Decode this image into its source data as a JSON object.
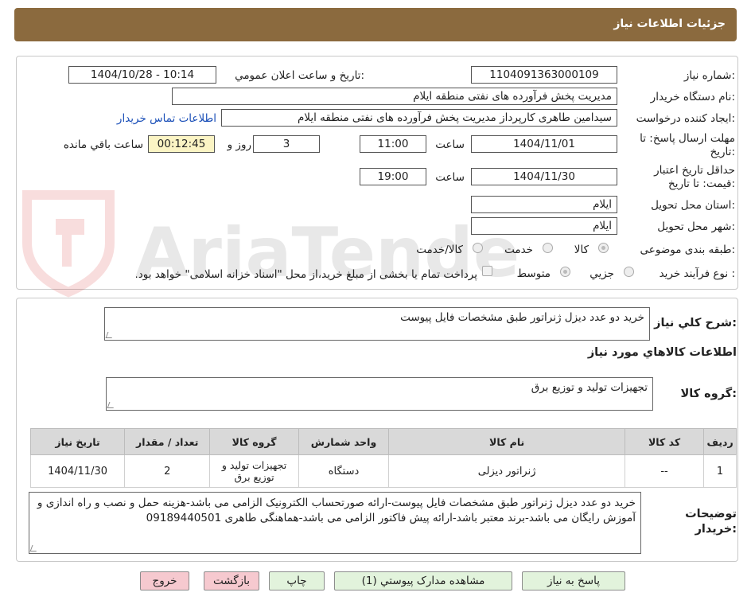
{
  "header": {
    "title": "جزئیات اطلاعات نیاز"
  },
  "fields": {
    "need_number_label": "شماره نیاز:",
    "need_number": "1104091363000109",
    "announce_label": "تاریخ و ساعت اعلان عمومي:",
    "announce_value": "1404/10/28 - 10:14",
    "buyer_org_label": "نام دستگاه خريدار:",
    "buyer_org": "مدیریت پخش فرآورده های نفتی منطقه ایلام",
    "creator_label": "ایجاد کننده درخواست:",
    "creator": "سیدامین طاهری کارپرداز مدیریت پخش فرآورده های نفتی منطقه ایلام",
    "contact_link": "اطلاعات تماس خریدار",
    "deadline_label_1": "مهلت ارسال پاسخ: تا",
    "deadline_label_2": "تاریخ:",
    "deadline_date": "1404/11/01",
    "time_label": "ساعت",
    "deadline_time": "11:00",
    "days_value": "3",
    "days_label": "روز و",
    "remaining_time": "00:12:45",
    "remaining_label": "ساعت باقي مانده",
    "validity_label_1": "حداقل تاریخ اعتبار",
    "validity_label_2": "قیمت: تا تاریخ:",
    "validity_date": "1404/11/30",
    "validity_time_label": "ساعت",
    "validity_time": "19:00",
    "province_label": "استان محل تحویل:",
    "province": "ایلام",
    "city_label": "شهر محل تحویل:",
    "city": "ایلام",
    "category_label": "طبقه بندی موضوعی:",
    "category_options": [
      "کالا",
      "خدمت",
      "کالا/خدمت"
    ],
    "process_label": "نوع فرآیند خرید :",
    "process_options": [
      "جزیي",
      "متوسط"
    ],
    "payment_note": "پرداخت تمام یا بخشی از مبلغ خرید،از محل \"اسناد خزانه اسلامی\" خواهد بود."
  },
  "summary": {
    "label": "شرح کلي نیاز:",
    "text": "خرید دو عدد دیزل ژنراتور طبق مشخصات فایل پیوست",
    "goods_info_title": "اطلاعات کالاهاي مورد نیاز",
    "group_label": "گروه کالا:",
    "group_value": "تجهیزات تولید و توزیع برق"
  },
  "table": {
    "headers": [
      "ردیف",
      "کد کالا",
      "نام کالا",
      "واحد شمارش",
      "گروه کالا",
      "تعداد / مقدار",
      "تاریخ نیاز"
    ],
    "rows": [
      [
        "1",
        "--",
        "ژنراتور دیزلی",
        "دستگاه",
        "تجهیزات تولید و توزیع برق",
        "2",
        "1404/11/30"
      ]
    ]
  },
  "buyer_notes": {
    "label_1": "توضیحات",
    "label_2": "خریدار:",
    "text": "خرید دو عدد دیزل ژنراتور طبق مشخصات فایل پیوست-ارائه صورتحساب الکترونیک الزامی می باشد-هزینه حمل  و نصب و راه اندازی و آموزش  رایگان می باشد-برند معتبر باشد-ارائه پیش فاکتور الزامی می باشد-هماهنگی طاهری 09189440501"
  },
  "buttons": {
    "reply": "پاسخ به نیاز",
    "attachments": "مشاهده مدارک پیوستي (1)",
    "print": "چاپ",
    "back": "بازگشت",
    "exit": "خروج"
  },
  "watermark": {
    "text": "AriaTender.neT"
  },
  "colors": {
    "header": "#8b6a3e",
    "button_green": "#e2f3dc",
    "button_pink": "#f6c9cf",
    "timer_bg": "#fbf4c4",
    "link": "#1a4fb8"
  }
}
